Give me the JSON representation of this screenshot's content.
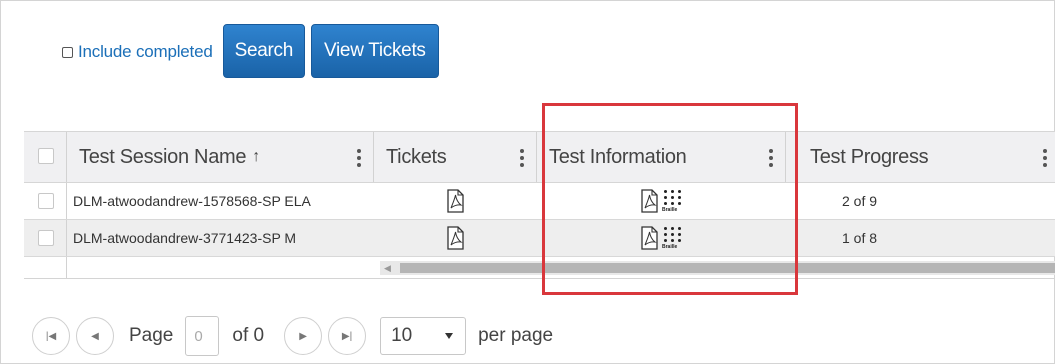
{
  "toolbar": {
    "include_completed_label": "Include completed",
    "search_label": "Search",
    "view_tickets_label": "View Tickets"
  },
  "grid": {
    "columns": [
      {
        "label": "Test Session Name",
        "sort_indicator": "↑"
      },
      {
        "label": "Tickets"
      },
      {
        "label": "Test Information"
      },
      {
        "label": "Test Progress"
      }
    ],
    "rows": [
      {
        "session_name": "DLM-atwoodandrew-1578568-SP ELA",
        "progress": "2 of 9"
      },
      {
        "session_name": "DLM-atwoodandrew-3771423-SP M",
        "progress": "1 of 8"
      }
    ],
    "braille_label": "Braille"
  },
  "pager": {
    "page_label": "Page",
    "page_value": "0",
    "of_label": "of 0",
    "page_size": "10",
    "per_page_label": "per page"
  },
  "icons": {
    "pdf": "pdf-icon",
    "braille": "braille-icon",
    "first": "first-page-icon",
    "prev": "prev-page-icon",
    "next": "next-page-icon",
    "last": "last-page-icon"
  },
  "colors": {
    "button_blue": "#1a63a8",
    "link_blue": "#1b6fb8",
    "highlight_red": "#d9373c",
    "header_bg": "#f0f0f2"
  }
}
